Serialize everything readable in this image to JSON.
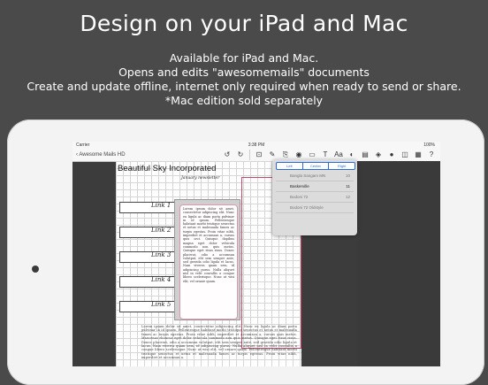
{
  "headline": "Design on your iPad and Mac",
  "blurb": [
    "Available for iPad and Mac.",
    "Opens and edits \"awesomemails\" documents",
    "Create and update offline, internet only required when ready to send or share.",
    "*Mac edition sold separately"
  ],
  "status": {
    "carrier": "Carrier",
    "time": "3:38 PM",
    "battery": "100%"
  },
  "toolbar": {
    "back_label": "Awesome Mails HD",
    "tools": [
      "↺",
      "↻",
      "⊡",
      "✎",
      "⎘",
      "◉",
      "▭",
      "T",
      "Aa",
      "◐",
      "▤",
      "◈",
      "●",
      "◫",
      "▦",
      "?"
    ]
  },
  "document": {
    "title": "Beautiful Sky Incorporated",
    "subtitle": "January newsletter",
    "links": [
      "Link 1",
      "Link 2",
      "Link 3",
      "Link 4",
      "Link 5"
    ],
    "card_text": "Lorem ipsum dolor sit amet, consectetur adipiscing elit. Nunc eu ligula ac diam porta pulvinar in id ipsum. Pellentesque habitant morbi tristique senectus et netus et malesuada fames ac turpis egestas. Proin vitae nibh, imperdiet et accumsan a, cursus quis orci. Quisque dapibus magna eget dolor vehicula commodo non quis metus. Quisque eget risus risus. Donec placerat, odio a accumsan volutpat, elit sem semper ante, sed gravida odio ligula et lacus. Nam viverra quam sem, id adipiscing purus. Nulla aliquet nisl in velit convallis a congue libero scelerisque. Nunc ut wisi elit, vel ornare quam.",
    "bottom_text": "Lorem ipsum dolor sit amet, consectetur adipiscing elit. Nunc eu ligula ac diam porta pulvinar in id ipsum. Pellentesque habitant morbi tristique senectus et netus et malesuada fames ac turpis egestas. Proin vitae nibh, imperdiet et accumsan a, cursus quis metus. Maecenas rhoncus eget dolor vehicula commodo non quis metus. Quisque eget risus risus. Donec placerat, odio a accumsan volutpat, elit sem semper ante, sed gravida odio ligula et lacus. Nam viverra quam sem, id adipiscing purus. Nulla aliquet nisl in velit convallis a congue libero scelerisque. Nunc ut wisi elit, vel ornare quam. Pellentesque habitant morbi tristique senectus et netus et malesuada fames ac turpis egestas. Proin vitae nibh, imperdiet et accumsan a."
  },
  "popover": {
    "alignment": [
      "Left",
      "Center",
      "Right"
    ],
    "fonts": [
      {
        "name": "Bangla Sangam MN",
        "size": "10",
        "selected": false
      },
      {
        "name": "Baskerville",
        "size": "11",
        "selected": true
      },
      {
        "name": "Bodoni 72",
        "size": "12",
        "selected": false
      },
      {
        "name": "Bodoni 72 Oldstyle",
        "size": "",
        "selected": false
      }
    ]
  },
  "colors": {
    "background": "#4a4a4a",
    "device": "#f3f3f3",
    "accent": "#2a6bd6",
    "frame": "#c14a6a"
  }
}
